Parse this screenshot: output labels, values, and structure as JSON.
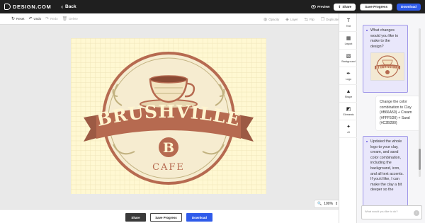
{
  "app": {
    "logo_text": "DESIGN.COM",
    "back_label": "Back",
    "preview_label": "Preview",
    "share_label": "Share",
    "save_progress_label": "Save Progress",
    "download_label": "Download"
  },
  "toolbar": {
    "reset": "Reset",
    "undo": "Undo",
    "redo": "Redo",
    "delete": "Delete",
    "opacity": "Opacity",
    "layer": "Layer",
    "flip": "Flip",
    "duplicate": "Duplicate"
  },
  "canvas": {
    "brand_name": "BRUSHVILLE",
    "initial": "B",
    "tagline": "CAFE",
    "zoom": "100%",
    "colors": {
      "background": "#FFF8D2",
      "clay": "#B66A50",
      "cream": "#FFF5D0",
      "sand": "#C2B280"
    }
  },
  "sidebar": {
    "items": [
      {
        "label": "Text",
        "icon": "text-icon"
      },
      {
        "label": "Layout",
        "icon": "layout-icon"
      },
      {
        "label": "Background",
        "icon": "background-icon"
      },
      {
        "label": "Logo",
        "icon": "logo-icon"
      },
      {
        "label": "Shape",
        "icon": "shape-icon"
      },
      {
        "label": "Elements",
        "icon": "elements-icon"
      },
      {
        "label": "AI",
        "icon": "ai-sparkle-icon"
      }
    ]
  },
  "chat": {
    "messages": [
      {
        "role": "assistant",
        "text": "What changes would you like to make to the design?"
      },
      {
        "role": "user",
        "text": "Change the color combination to Clay (#B66A50) + Cream (#FFF5D0) + Sand (#C2B280)"
      },
      {
        "role": "assistant",
        "text": "Updated the whole logo to your clay, cream, and sand color combination, including the background, icon, and all text accents. If you'd like, I can make the clay a bit deeper so the"
      }
    ],
    "thumb_text": "BRUSHVILLE",
    "input_placeholder": "What would you like to do?"
  },
  "bottom": {
    "share_label": "Share",
    "save_progress_label": "Save Progress",
    "download_label": "Download"
  }
}
